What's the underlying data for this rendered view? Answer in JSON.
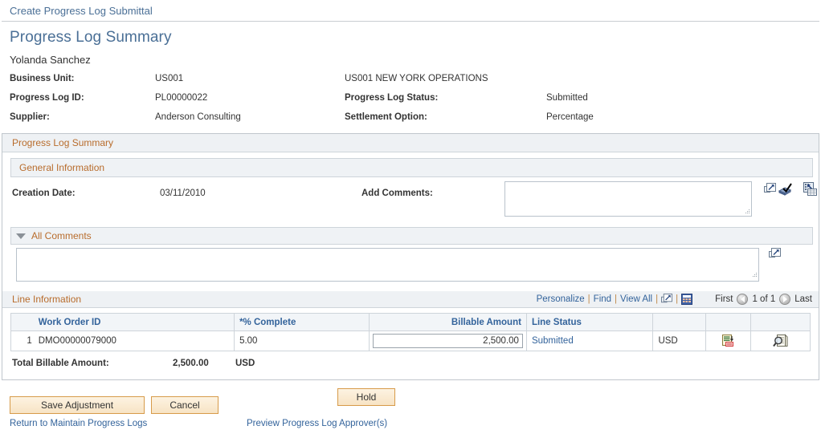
{
  "breadcrumb": {
    "label": "Create Progress Log Submittal"
  },
  "page": {
    "title": "Progress Log Summary",
    "user_name": "Yolanda Sanchez"
  },
  "header_fields": {
    "business_unit_label": "Business Unit:",
    "business_unit_value": "US001",
    "business_unit_desc": "US001 NEW YORK OPERATIONS",
    "progress_log_id_label": "Progress Log ID:",
    "progress_log_id_value": "PL00000022",
    "progress_log_status_label": "Progress Log Status:",
    "progress_log_status_value": "Submitted",
    "supplier_label": "Supplier:",
    "supplier_value": "Anderson Consulting",
    "settlement_option_label": "Settlement Option:",
    "settlement_option_value": "Percentage"
  },
  "summary_section": {
    "title": "Progress Log Summary",
    "general_information": {
      "title": "General Information",
      "creation_date_label": "Creation Date:",
      "creation_date_value": "03/11/2010",
      "add_comments_label": "Add Comments:",
      "add_comments_value": "",
      "add_comments_placeholder": "",
      "expand_icon": "expand-popup-icon",
      "spellcheck_icon": "spell-check-icon",
      "grid_expand_icon": "grid-expand-icon"
    },
    "all_comments": {
      "title": "All Comments",
      "toggle_icon": "collapse-triangle-down-icon",
      "text_value": "",
      "text_placeholder": "",
      "expand_icon": "expand-popup-icon"
    },
    "line_information": {
      "title": "Line Information",
      "tools": {
        "personalize": "Personalize",
        "find": "Find",
        "view_all": "View All",
        "download_icon": "download-popup-icon",
        "grid_icon": "grid-view-icon",
        "separator": "|"
      },
      "pager": {
        "first": "First",
        "prev_icon": "prev-arrow-icon",
        "counter": "1 of 1",
        "next_icon": "next-arrow-icon",
        "last": "Last"
      },
      "columns": {
        "row_num": "",
        "work_order_id": "Work Order ID",
        "pct_complete": "*% Complete",
        "billable_amount": "Billable Amount",
        "line_status": "Line Status",
        "currency": "",
        "icon_col_1": "",
        "icon_col_2": ""
      },
      "rows": [
        {
          "num": "1",
          "work_order_id": "DMO00000079000",
          "pct_complete": "5.00",
          "billable_amount": "2,500.00",
          "line_status": "Submitted",
          "currency": "USD",
          "notes_icon": "line-notes-icon",
          "details_icon": "line-details-search-icon"
        }
      ],
      "total_label": "Total Billable Amount:",
      "total_value": "2,500.00",
      "total_currency": "USD"
    }
  },
  "footer": {
    "save_adjustment": "Save Adjustment",
    "cancel": "Cancel",
    "hold": "Hold",
    "return_link": "Return to Maintain Progress Logs",
    "preview_link": "Preview Progress Log Approver(s)"
  },
  "colors": {
    "link_blue": "#33639b",
    "title_blue": "#4a6f96",
    "section_orange": "#b86c2c",
    "button_border": "#d79b4a",
    "header_bg": "#eef1f4"
  }
}
